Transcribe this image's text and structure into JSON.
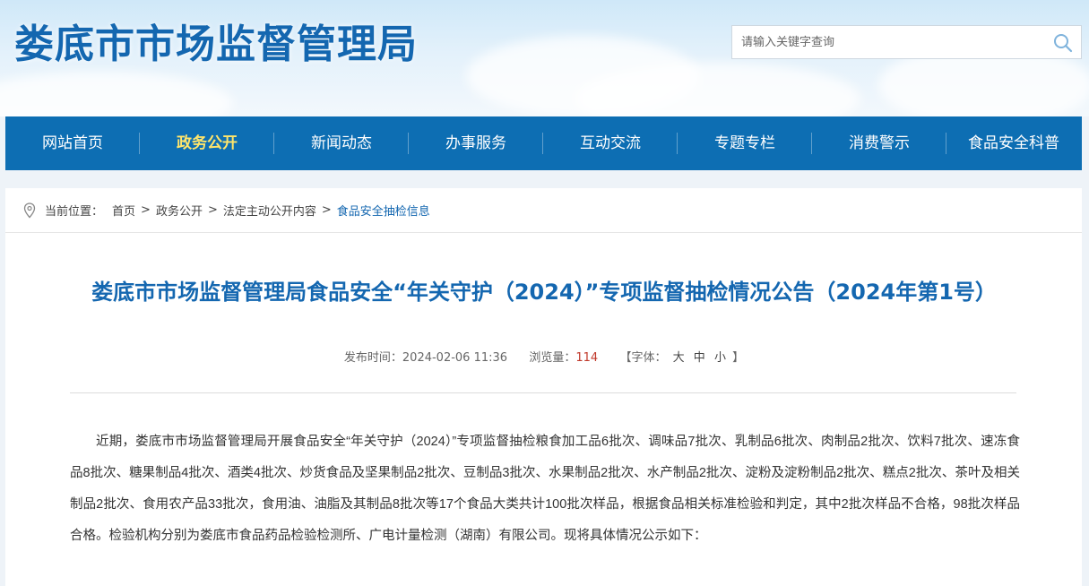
{
  "site": {
    "title": "娄底市市场监督管理局",
    "search_placeholder": "请输入关键字查询"
  },
  "nav": {
    "items": [
      {
        "label": "网站首页"
      },
      {
        "label": "政务公开"
      },
      {
        "label": "新闻动态"
      },
      {
        "label": "办事服务"
      },
      {
        "label": "互动交流"
      },
      {
        "label": "专题专栏"
      },
      {
        "label": "消费警示"
      },
      {
        "label": "食品安全科普"
      }
    ],
    "active_index": 1
  },
  "breadcrumb": {
    "label": "当前位置：",
    "items": [
      "首页",
      "政务公开",
      "法定主动公开内容",
      "食品安全抽检信息"
    ],
    "separator": ">"
  },
  "article": {
    "title": "娄底市市场监督管理局食品安全“年关守护（2024）”专项监督抽检情况公告（2024年第1号）",
    "meta": {
      "publish_label": "发布时间：",
      "publish_time": "2024-02-06 11:36",
      "views_label": "浏览量：",
      "views": "114",
      "font_label_open": "【字体：",
      "font_large": "大",
      "font_medium": "中",
      "font_small": "小",
      "font_label_close": "】"
    },
    "body": "近期，娄底市市场监督管理局开展食品安全“年关守护（2024）”专项监督抽检粮食加工品6批次、调味品7批次、乳制品6批次、肉制品2批次、饮料7批次、速冻食品8批次、糖果制品4批次、酒类4批次、炒货食品及坚果制品2批次、豆制品3批次、水果制品2批次、水产制品2批次、淀粉及淀粉制品2批次、糕点2批次、茶叶及相关制品2批次、食用农产品33批次，食用油、油脂及其制品8批次等17个食品大类共计100批次样品，根据食品相关标准检验和判定，其中2批次样品不合格，98批次样品合格。检验机构分别为娄底市食品药品检验检测所、广电计量检测（湖南）有限公司。现将具体情况公示如下："
  },
  "colors": {
    "brand_blue": "#1467b0",
    "nav_bg": "#0d6eb3",
    "nav_active": "#ffe56b",
    "views_red": "#c0392b"
  },
  "icons": {
    "search": "search-icon",
    "location": "location-pin-icon"
  }
}
